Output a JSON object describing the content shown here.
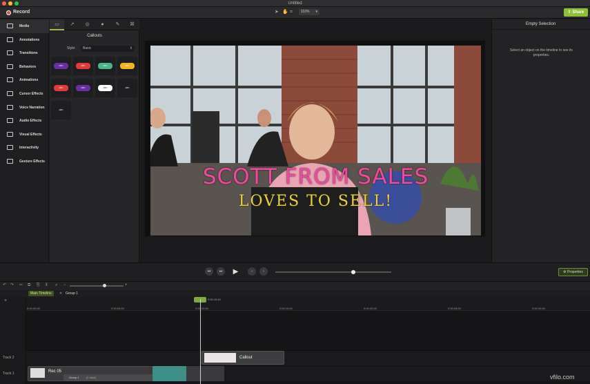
{
  "window": {
    "title": "Untitled"
  },
  "toolbar": {
    "record_label": "Record",
    "zoom_value": "110%",
    "share_label": "Share"
  },
  "leftnav": {
    "items": [
      {
        "label": "Media",
        "icon": "film-icon",
        "active": true
      },
      {
        "label": "Annotations",
        "icon": "annotation-icon"
      },
      {
        "label": "Transitions",
        "icon": "transition-icon"
      },
      {
        "label": "Behaviors",
        "icon": "behavior-icon"
      },
      {
        "label": "Animations",
        "icon": "animation-icon"
      },
      {
        "label": "Cursor Effects",
        "icon": "cursor-icon"
      },
      {
        "label": "Voice Narration",
        "icon": "microphone-icon"
      },
      {
        "label": "Audio Effects",
        "icon": "speaker-icon"
      },
      {
        "label": "Visual Effects",
        "icon": "wand-icon"
      },
      {
        "label": "Interactivity",
        "icon": "interactivity-icon"
      },
      {
        "label": "Gesture Effects",
        "icon": "hand-icon"
      }
    ]
  },
  "panel": {
    "title": "Callouts",
    "style_label": "Style:",
    "style_value": "Basic",
    "thumbs": [
      {
        "text": "ABC",
        "color": "#6a2fa0"
      },
      {
        "text": "ABC",
        "color": "#e13b3b"
      },
      {
        "text": "ABC",
        "color": "#4bb58c"
      },
      {
        "text": "ABC",
        "color": "#f3b51e"
      },
      {
        "text": "ABC",
        "color": "#e13b3b"
      },
      {
        "text": "ABC",
        "color": "#6a2fa0"
      },
      {
        "text": "ABC",
        "color": "#ffffff"
      },
      {
        "text": "ABC",
        "color": "#1e1e20"
      },
      {
        "text": "ABC",
        "color": "#1e1e20"
      }
    ]
  },
  "preview": {
    "caption_line1": "SCOTT FROM SALES",
    "caption_line2": "LOVES TO SELL!"
  },
  "properties": {
    "title": "Empty Selection",
    "message": "Select an object on the timeline to see its properties.",
    "button_label": "Properties"
  },
  "timeline": {
    "tabs": [
      {
        "label": "Main Timeline"
      },
      {
        "label": "Group 1"
      }
    ],
    "playhead_time": "0:00:10;10",
    "ticks": [
      "0:00:00;00",
      "0:00:05;00",
      "0:00:10;00",
      "0:00:15;00",
      "0:00:20;00",
      "0:00:25;00",
      "0:00:30;00"
    ],
    "tracks": [
      {
        "label": "Track 2"
      },
      {
        "label": "Track 1"
      }
    ],
    "callout_clip": {
      "label": "Callout"
    },
    "rec_clip": {
      "label": "Rec 05",
      "group_label": "Group 1",
      "group_count": "(2 clips)"
    }
  },
  "watermark": "vfilo.com",
  "colors": {
    "accent": "#8fbf3a",
    "record": "#e14b4b",
    "caption_pink": "#e94e9c",
    "caption_yellow": "#e7cf4a"
  }
}
